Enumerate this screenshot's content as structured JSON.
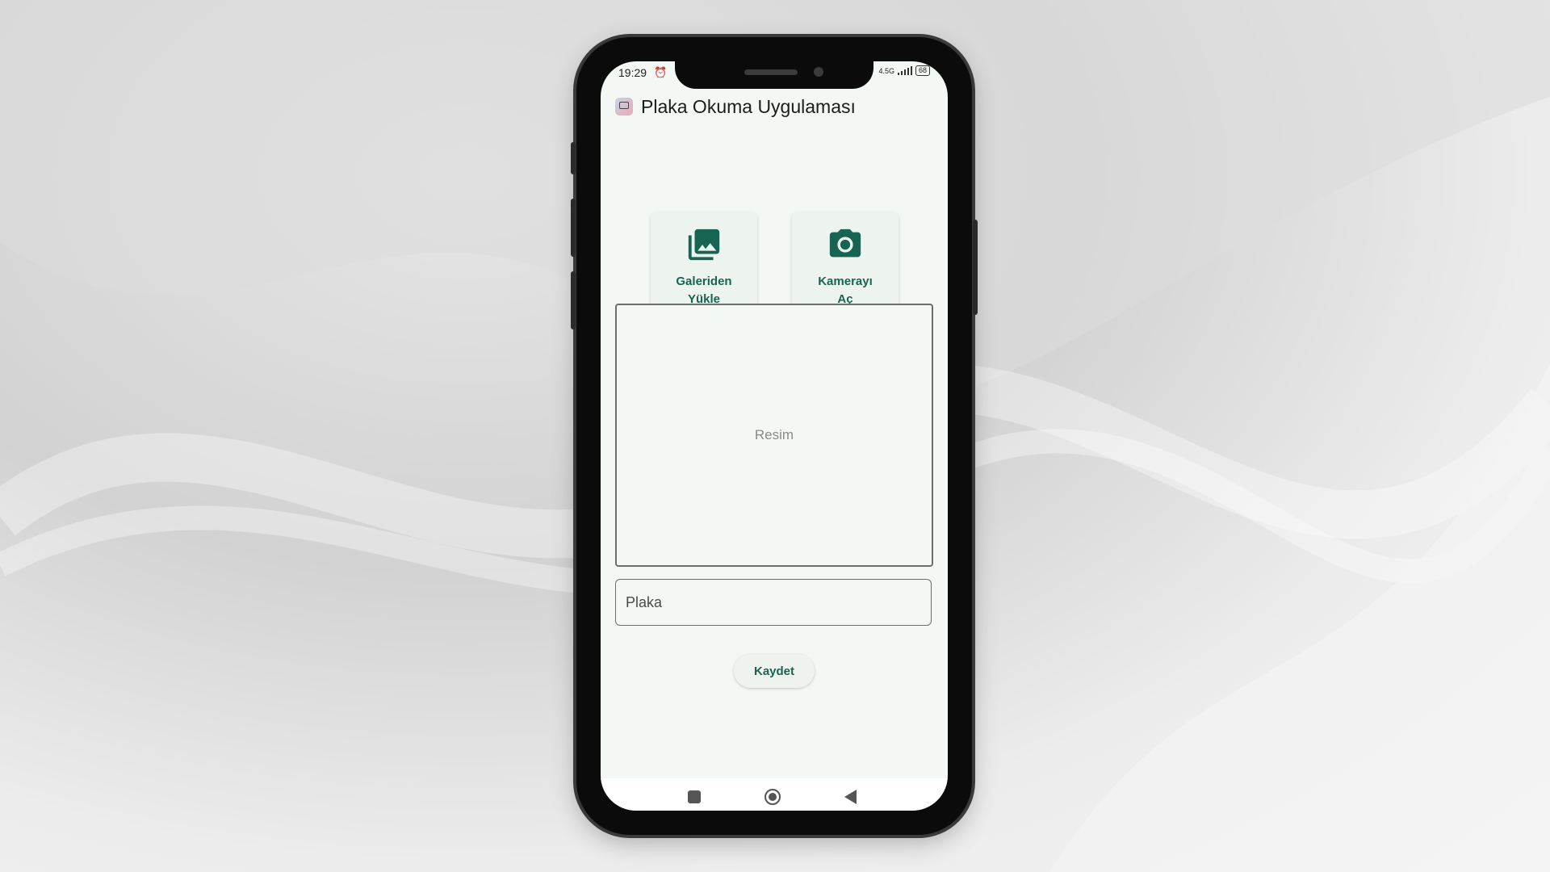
{
  "status_bar": {
    "time": "19:29",
    "alarm_icon": "alarm-clock-icon",
    "network": "4.5G",
    "battery": "68"
  },
  "app_bar": {
    "icon": "plate-camera-app-icon",
    "title": "Plaka Okuma Uygulaması"
  },
  "actions": {
    "gallery": {
      "icon": "photo-library-icon",
      "label": "Galeriden\nYükle"
    },
    "camera": {
      "icon": "camera-icon",
      "label": "Kamerayı\nAç"
    }
  },
  "image_preview": {
    "label": "Resim"
  },
  "plate_input": {
    "placeholder": "Plaka",
    "value": ""
  },
  "save_button": {
    "label": "Kaydet"
  },
  "nav_bar": {
    "recents_icon": "recents-square-icon",
    "home_icon": "home-circle-icon",
    "back_icon": "back-triangle-icon"
  },
  "colors": {
    "accent": "#186452",
    "screen_background": "#f3f8f4",
    "button_background": "#edf3ee"
  }
}
